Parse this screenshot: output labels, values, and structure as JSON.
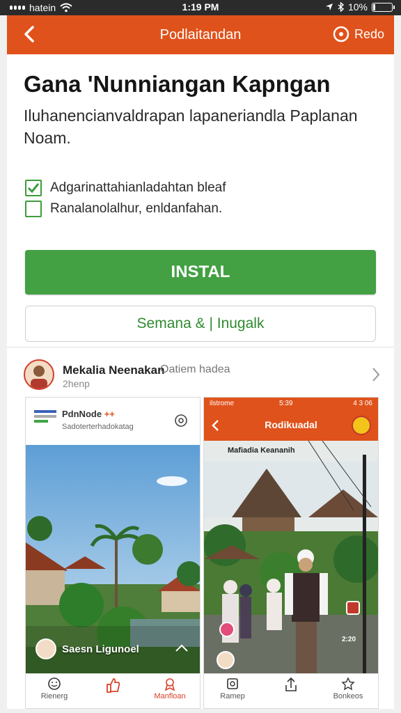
{
  "status_bar": {
    "carrier": "hatein",
    "time": "1:19 PM",
    "battery": "10%",
    "battery_level": 0.1
  },
  "app_bar": {
    "title": "Podlaitandan",
    "help_label": "Redo"
  },
  "listing": {
    "title": "Gana 'Nunniangan Kapngan",
    "description": "Iluhanencianvaldrapan lapaneriandla Paplanan Noam.",
    "options": [
      {
        "label": "Adgarinattahianladahtan bleaf",
        "checked": true
      },
      {
        "label": "Ranalanolalhur, enldanfahan.",
        "checked": false
      }
    ],
    "install_label": "INSTAL",
    "secondary_label": "Semana & | Inugalk"
  },
  "author": {
    "name": "Mekalia Neenakan",
    "subtitle": "Oatiem hadea",
    "time": "2henp"
  },
  "screenshot_1": {
    "brand_a": "PdnNode",
    "brand_b": "++",
    "tagline": "Sadoterterhadokatag",
    "caption": "Saesn Ligunoel",
    "nav": [
      "Rienerg",
      "",
      "Manfloan"
    ]
  },
  "screenshot_2": {
    "status_left": "ilstrome",
    "status_mid": "5:39",
    "status_right": "4 3 06",
    "title": "Rodikuadal",
    "heading": "Mafiadia Keananih",
    "timer": "2:20",
    "nav": [
      "Ramep",
      "",
      "Bonkeos"
    ]
  },
  "colors": {
    "brand_orange": "#e0521b",
    "install_green": "#43a043",
    "accent_red": "#d94329"
  }
}
